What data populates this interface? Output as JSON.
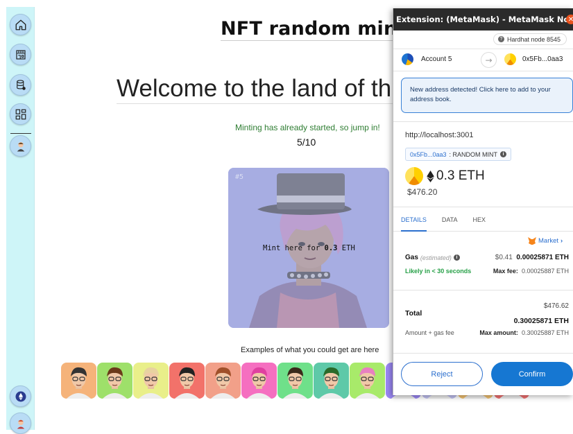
{
  "page": {
    "title": "NFT random mint",
    "welcome": "Welcome to the land of th",
    "mint_status": "Minting has already started, so jump in!",
    "mint_count": "5/10",
    "nft_card": {
      "number": "#5",
      "mint_text": "Mint here for ",
      "mint_price": "0.3",
      "mint_currency": " ETH"
    },
    "examples_label": "Examples of what you could get are here",
    "example_backgrounds": [
      "#f5b37a",
      "#9ee06a",
      "#e9ef8a",
      "#f2726a",
      "#f2a089",
      "#f56fc0",
      "#6fe08a",
      "#5ec9a8",
      "#a8ea6a",
      "#9b88f5",
      "#c0c0f0",
      "#f0c070",
      "#f07070"
    ]
  },
  "sidebar": {
    "items": [
      {
        "name": "home-icon"
      },
      {
        "name": "storefront-icon"
      },
      {
        "name": "database-icon"
      },
      {
        "name": "dashboard-icon"
      },
      {
        "name": "profile-avatar"
      }
    ],
    "bottom": [
      {
        "name": "ethereum-icon"
      },
      {
        "name": "user-avatar"
      }
    ]
  },
  "metamask": {
    "window_title": "Extension: (MetaMask) - MetaMask Notifica...",
    "network": "Hardhat node 8545",
    "from_account": "Account 5",
    "to_account": "0x5Fb...0aa3",
    "notice": "New address detected! Click here to add to your address book.",
    "origin": "http://localhost:3001",
    "method_address": "0x5Fb...0aa3",
    "method_name": " : RANDOM MINT",
    "amount": "0.3 ETH",
    "amount_usd": "$476.20",
    "tabs": [
      "DETAILS",
      "DATA",
      "HEX"
    ],
    "market": "Market",
    "gas_label": "Gas",
    "gas_estimated": "(estimated)",
    "gas_usd": "$0.41",
    "gas_eth": "0.00025871 ETH",
    "likely": "Likely in < 30 seconds",
    "max_fee_label": "Max fee:",
    "max_fee_value": "0.00025887 ETH",
    "total_label": "Total",
    "total_usd": "$476.62",
    "total_eth": "0.30025871 ETH",
    "amount_gas_label": "Amount + gas fee",
    "max_amount_label": "Max amount:",
    "max_amount_value": "0.30025887 ETH",
    "reject": "Reject",
    "confirm": "Confirm",
    "colors": {
      "accent": "#1677d2",
      "success": "#26a047",
      "titlebar": "#2b2b2b"
    }
  }
}
